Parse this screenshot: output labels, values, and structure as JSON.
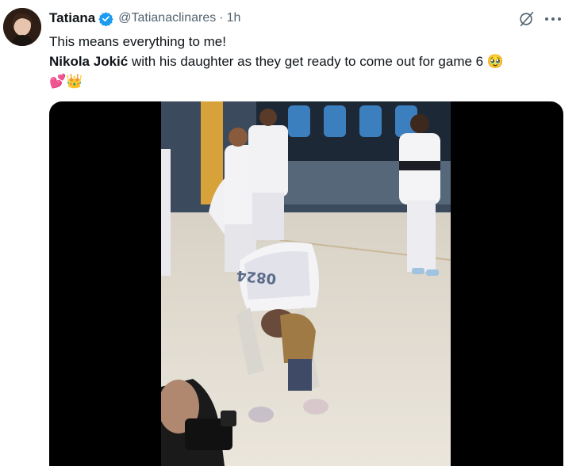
{
  "author": {
    "name": "Tatiana",
    "handle": "@Tatianaclinares",
    "separator": "·",
    "time": "1h",
    "verified": true
  },
  "tweet": {
    "line1": "This means everything to me!",
    "line2_bold": "Nikola Jokić",
    "line2_rest": " with his daughter as they get ready to come out for game 6 🥹",
    "line3": "💕👑"
  },
  "icons": {
    "verified": "verified-badge-icon",
    "grok": "grok-icon",
    "more": "more-icon"
  },
  "media": {
    "type": "video",
    "jersey_number": "0824"
  },
  "colors": {
    "verified": "#1d9bf0",
    "secondary_text": "#536471",
    "primary_text": "#0f1419"
  }
}
